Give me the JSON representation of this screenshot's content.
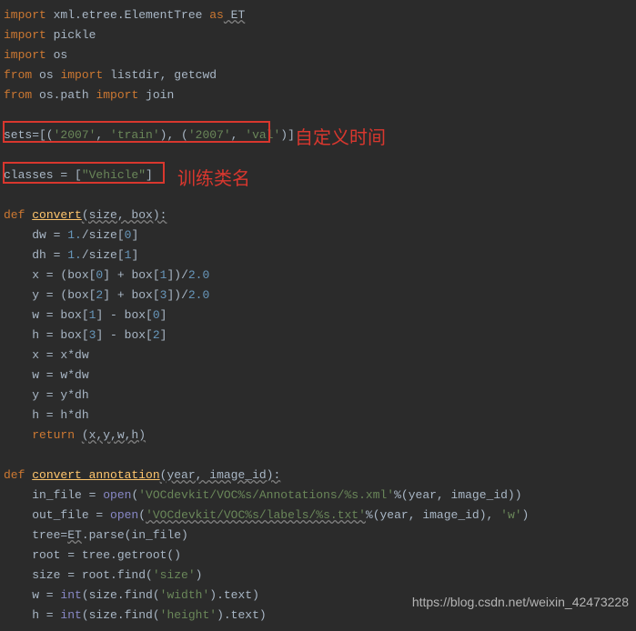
{
  "code": {
    "l1_import": "import",
    "l1_mod": " xml.etree.ElementTree ",
    "l1_as": "as",
    "l1_alias": " ET",
    "l2_import": "import",
    "l2_mod": " pickle",
    "l3_import": "import",
    "l3_mod": " os",
    "l4_from": "from",
    "l4_mod": " os ",
    "l4_import": "import",
    "l4_items": " listdir, getcwd",
    "l5_from": "from",
    "l5_mod": " os.path ",
    "l5_import": "import",
    "l5_items": " join",
    "sets_var": "sets=[(",
    "sets_s1": "'2007'",
    "sets_c1": ", ",
    "sets_s2": "'train'",
    "sets_c2": "), (",
    "sets_s3": "'2007'",
    "sets_c3": ", ",
    "sets_s4": "'val'",
    "sets_end": ")]",
    "classes_var": "classes = [",
    "classes_val": "\"Vehicle\"",
    "classes_end": "]",
    "def1": "def ",
    "func1": "convert",
    "func1_params": "(size, box):",
    "dw1": "    dw = ",
    "dw_num": "1.",
    "dw2": "/size[",
    "dw_idx": "0",
    "dw3": "]",
    "dh1": "    dh = ",
    "dh_num": "1.",
    "dh2": "/size[",
    "dh_idx": "1",
    "dh3": "]",
    "x1": "    x = (box[",
    "x_i0": "0",
    "x2": "] + box[",
    "x_i1": "1",
    "x3": "])/",
    "x_div": "2.0",
    "y1": "    y = (box[",
    "y_i0": "2",
    "y2": "] + box[",
    "y_i1": "3",
    "y3": "])/",
    "y_div": "2.0",
    "w1": "    w = box[",
    "w_i0": "1",
    "w2": "] - box[",
    "w_i1": "0",
    "w3": "]",
    "h1": "    h = box[",
    "h_i0": "3",
    "h2": "] - box[",
    "h_i1": "2",
    "h3": "]",
    "xdw": "    x = x*dw",
    "wdw": "    w = w*dw",
    "ydh": "    y = y*dh",
    "hdh": "    h = h*dh",
    "ret": "    return ",
    "ret_val": "(x,y,w,h)",
    "def2": "def ",
    "func2": "convert_annotation",
    "func2_params": "(year, image_id):",
    "in1": "    in_file = ",
    "open1": "open",
    "in2": "(",
    "in_str": "'VOCdevkit/VOC%s/Annotations/%s.xml'",
    "in3": "%(year, image_id))",
    "out1": "    out_file = ",
    "out2": "(",
    "out_str": "'VOCdevkit/VOC%s/labels/%s.txt'",
    "out3": "%(year, image_id), ",
    "out_mode": "'w'",
    "out4": ")",
    "tree1": "    tree=",
    "tree_et": "ET",
    "tree2": ".parse(in_file)",
    "root": "    root = tree.getroot()",
    "size1": "    size = root.find(",
    "size_str": "'size'",
    "size2": ")",
    "wint1": "    w = ",
    "int_call": "int",
    "wint2": "(size.find(",
    "wint_str": "'width'",
    "wint3": ").text)",
    "hint1": "    h = ",
    "hint2": "(size.find(",
    "hint_str": "'height'",
    "hint3": ").text)"
  },
  "annotations": {
    "sets_label": "自定义时间",
    "classes_label": "训练类名"
  },
  "watermark": "https://blog.csdn.net/weixin_42473228"
}
